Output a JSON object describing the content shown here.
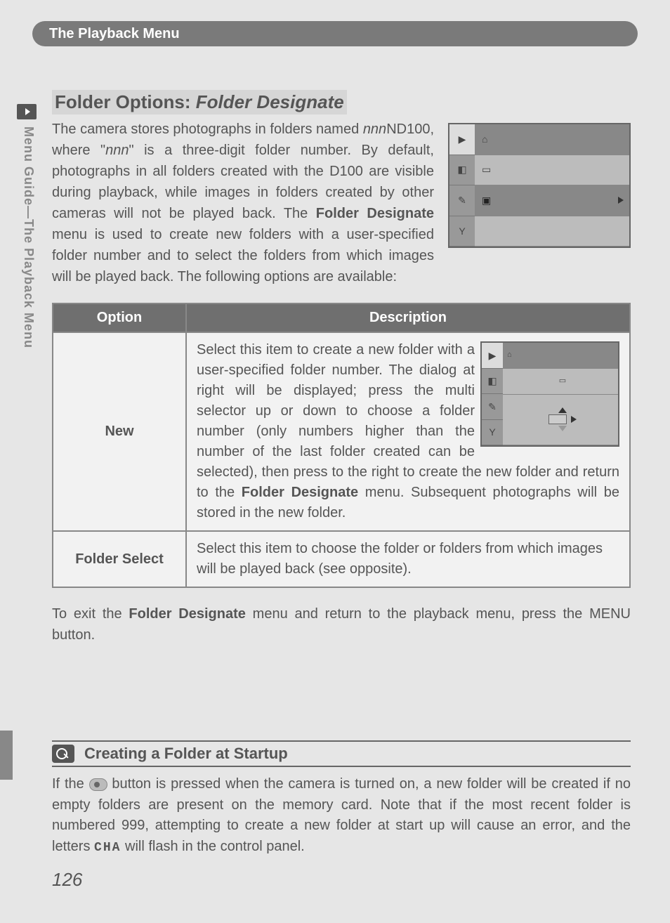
{
  "header": {
    "title": "The Playback Menu"
  },
  "side_label": "Menu Guide—The Playback Menu",
  "section": {
    "title_prefix": "Folder Options: ",
    "title_em": "Folder Designate",
    "intro_1": "The camera stores photographs in folders named ",
    "intro_nnn": "nnn",
    "intro_2": "ND100, where \"",
    "intro_3": "\" is a three-digit folder number.  By default, photographs in all folders created with the D100 are visible during playback, while images in folders created by other cameras will not be played back.  The ",
    "intro_bold": "Folder Designate",
    "intro_4": " menu is used to create new folders with a user-specified folder number and to select the folders from which images will be played back.  The following options are available:"
  },
  "table": {
    "headers": [
      "Option",
      "Description"
    ],
    "rows": [
      {
        "option": "New",
        "desc_1": "Select this item to create a new folder with a user-specified folder number.  The dialog at right will be displayed; press the multi selector up or down to choose a folder number (only numbers higher than the number of the last folder created can be selected), then press to the right to create the new folder and return to the ",
        "desc_bold": "Folder Designate",
        "desc_2": " menu.  Subsequent photographs will be stored in the new folder."
      },
      {
        "option": "Folder Select",
        "desc_1": "Select this item to choose the folder or folders from which images will be played back (see opposite)."
      }
    ]
  },
  "exit": {
    "p1": "To exit the ",
    "bold": "Folder Designate",
    "p2": " menu and return to the playback menu, press the ",
    "menu_word": "MENU",
    "p3": " button."
  },
  "tip": {
    "title": "Creating a Folder at Startup",
    "b1": "If the ",
    "b2": " button is pressed when the camera is turned on, a new folder will be created if no empty folders are present on the memory card.  Note that if the most recent folder is numbered 999, attempting to create a new folder at start up will cause an error, and the letters ",
    "seg": "CHA",
    "b3": " will flash in the control panel."
  },
  "page_number": "126"
}
